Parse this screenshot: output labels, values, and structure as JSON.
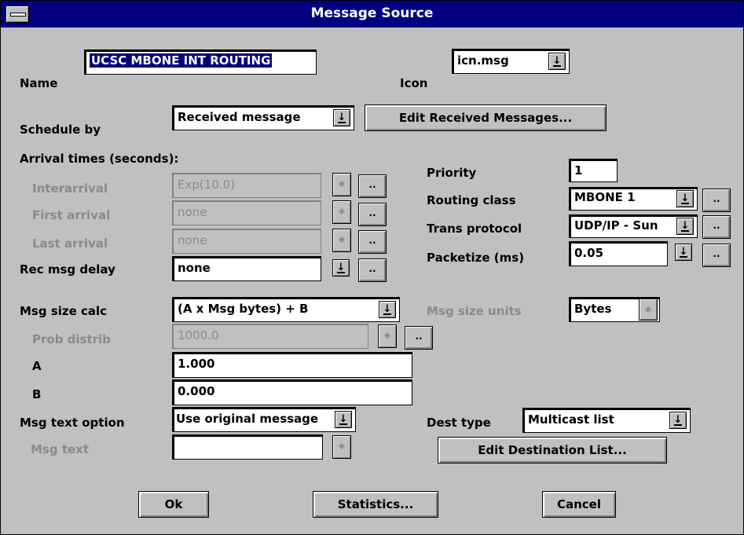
{
  "window": {
    "title": "Message Source"
  },
  "icons": {
    "system_menu": "system-menu-icon",
    "dropdown": "down-arrow-icon",
    "spinner": "spinner-icon"
  },
  "form": {
    "name_label": "Name",
    "name_value": "UCSC MBONE INT ROUTING",
    "icon_label": "Icon",
    "icon_value": "icn.msg",
    "schedule_label": "Schedule by",
    "schedule_value": "Received message",
    "edit_received_button": "Edit Received Messages...",
    "arrival_header": "Arrival times (seconds):",
    "interarrival_label": "Interarrival",
    "interarrival_value": "Exp(10.0)",
    "first_arrival_label": "First arrival",
    "first_arrival_value": "none",
    "last_arrival_label": "Last arrival",
    "last_arrival_value": "none",
    "rec_msg_delay_label": "Rec msg delay",
    "rec_msg_delay_value": "none",
    "priority_label": "Priority",
    "priority_value": "1",
    "routing_class_label": "Routing class",
    "routing_class_value": "MBONE 1",
    "trans_protocol_label": "Trans protocol",
    "trans_protocol_value": "UDP/IP - Sun",
    "packetize_label": "Packetize (ms)",
    "packetize_value": "0.05",
    "msg_size_calc_label": "Msg size calc",
    "msg_size_calc_value": "(A x Msg bytes) + B",
    "msg_size_units_label": "Msg size units",
    "msg_size_units_value": "Bytes",
    "prob_distrib_label": "Prob distrib",
    "prob_distrib_value": "1000.0",
    "a_label": "A",
    "a_value": "1.000",
    "b_label": "B",
    "b_value": "0.000",
    "msg_text_option_label": "Msg text option",
    "msg_text_option_value": "Use original message",
    "msg_text_label": "Msg text",
    "msg_text_value": "",
    "dest_type_label": "Dest type",
    "dest_type_value": "Multicast list",
    "edit_dest_button": "Edit Destination List...",
    "dots_label": ".."
  },
  "buttons": {
    "ok": "Ok",
    "statistics": "Statistics...",
    "cancel": "Cancel"
  },
  "colors": {
    "titlebar": "#000080",
    "dialog": "#c0c0c0",
    "disabled_text": "#8a8a8a"
  }
}
